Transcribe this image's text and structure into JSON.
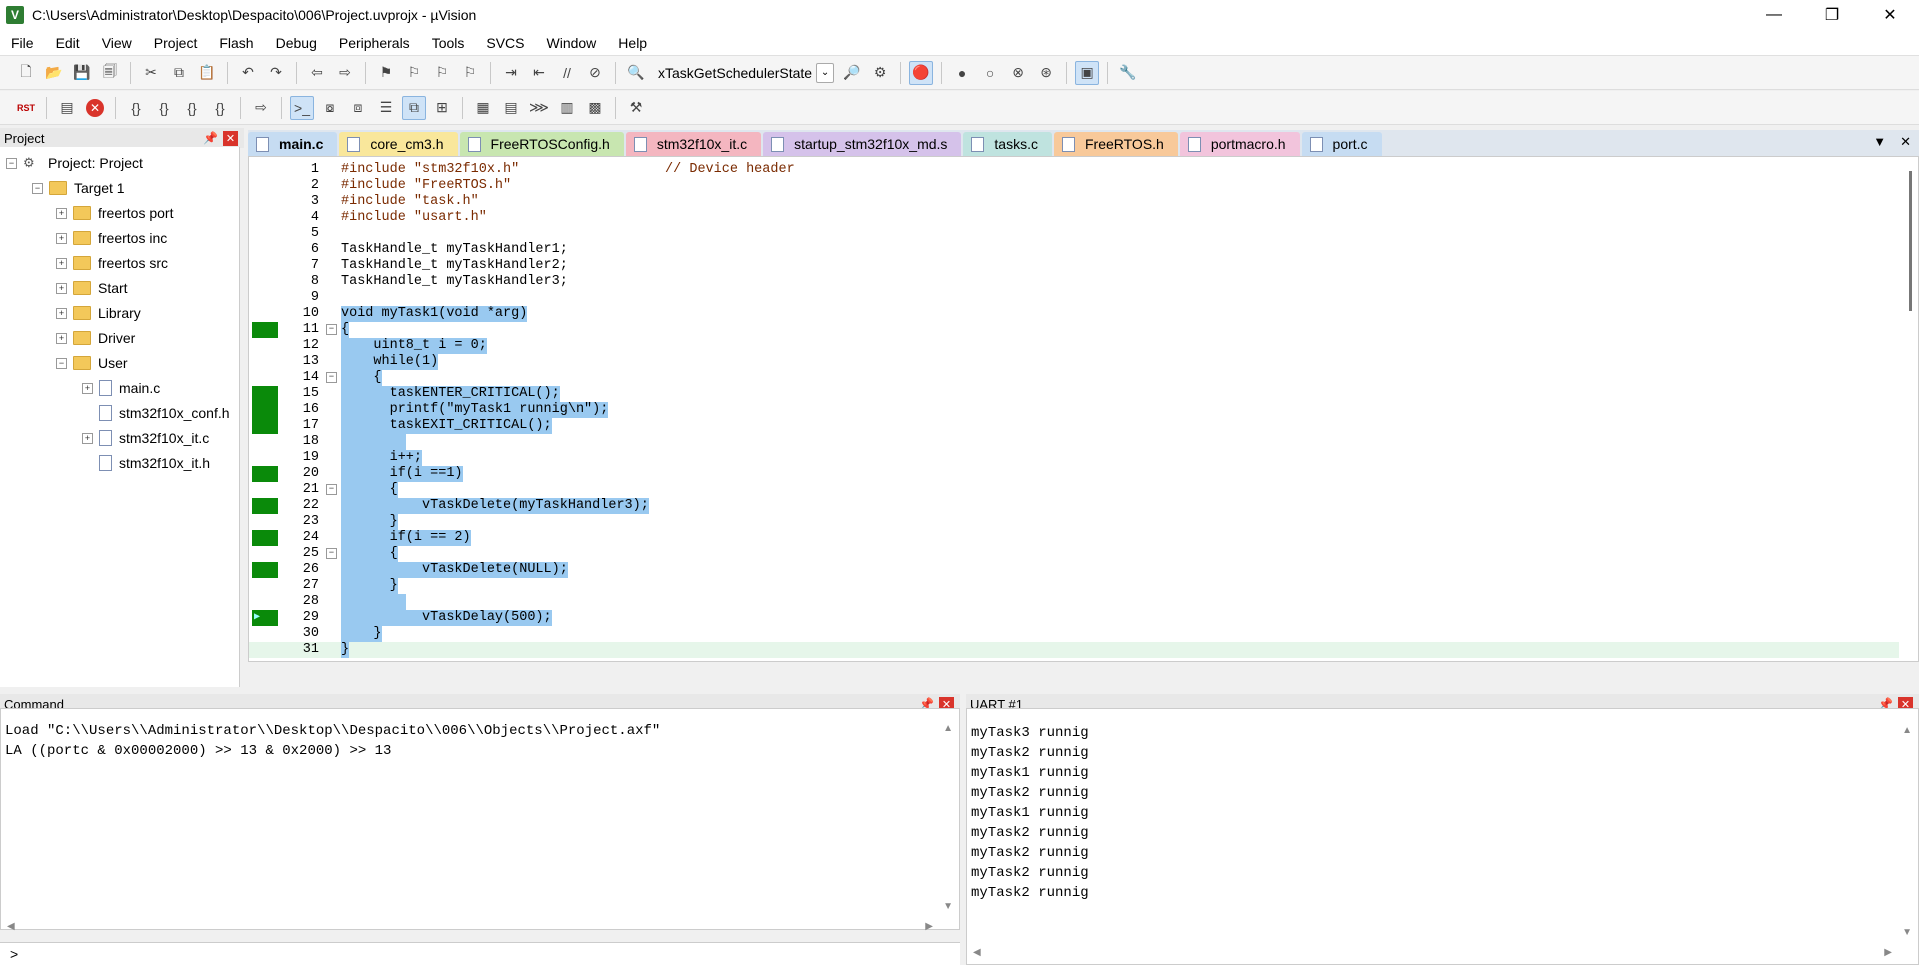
{
  "window": {
    "title": "C:\\Users\\Administrator\\Desktop\\Despacito\\006\\Project.uvprojx - µVision",
    "app_icon": "V",
    "minimize": "—",
    "restore": "❐",
    "close": "✕"
  },
  "menu": [
    "File",
    "Edit",
    "View",
    "Project",
    "Flash",
    "Debug",
    "Peripherals",
    "Tools",
    "SVCS",
    "Window",
    "Help"
  ],
  "toolbar": {
    "function_combo": "xTaskGetSchedulerState",
    "rst_label": "RST"
  },
  "project_panel": {
    "title": "Project",
    "root": "Project: Project",
    "target": "Target 1",
    "groups": [
      "freertos port",
      "freertos inc",
      "freertos src",
      "Start",
      "Library",
      "Driver",
      "User"
    ],
    "user_files": [
      "main.c",
      "stm32f10x_conf.h",
      "stm32f10x_it.c",
      "stm32f10x_it.h"
    ]
  },
  "tabs": [
    {
      "label": "main.c",
      "color": "#c6dcf2"
    },
    {
      "label": "core_cm3.h",
      "color": "#f9e79b"
    },
    {
      "label": "FreeRTOSConfig.h",
      "color": "#c8e6b0"
    },
    {
      "label": "stm32f10x_it.c",
      "color": "#f4b6c0"
    },
    {
      "label": "startup_stm32f10x_md.s",
      "color": "#d5c2ea"
    },
    {
      "label": "tasks.c",
      "color": "#bfe3df"
    },
    {
      "label": "FreeRTOS.h",
      "color": "#f8c99a"
    },
    {
      "label": "portmacro.h",
      "color": "#f2c4dc"
    },
    {
      "label": "port.c",
      "color": "#c6dcf2"
    }
  ],
  "code_lines": [
    {
      "n": "1",
      "t": "#include \"stm32f10x.h\"                  // Device header"
    },
    {
      "n": "2",
      "t": "#include \"FreeRTOS.h\""
    },
    {
      "n": "3",
      "t": "#include \"task.h\""
    },
    {
      "n": "4",
      "t": "#include \"usart.h\""
    },
    {
      "n": "5",
      "t": ""
    },
    {
      "n": "6",
      "t": "TaskHandle_t myTaskHandler1;"
    },
    {
      "n": "7",
      "t": "TaskHandle_t myTaskHandler2;"
    },
    {
      "n": "8",
      "t": "TaskHandle_t myTaskHandler3;"
    },
    {
      "n": "9",
      "t": ""
    },
    {
      "n": "10",
      "t": "void myTask1(void *arg)"
    },
    {
      "n": "11",
      "t": "{"
    },
    {
      "n": "12",
      "t": "    uint8_t i = 0;"
    },
    {
      "n": "13",
      "t": "    while(1)"
    },
    {
      "n": "14",
      "t": "    {"
    },
    {
      "n": "15",
      "t": "      taskENTER_CRITICAL();"
    },
    {
      "n": "16",
      "t": "      printf(\"myTask1 runnig\\n\");"
    },
    {
      "n": "17",
      "t": "      taskEXIT_CRITICAL();"
    },
    {
      "n": "18",
      "t": "        "
    },
    {
      "n": "19",
      "t": "      i++;"
    },
    {
      "n": "20",
      "t": "      if(i ==1)"
    },
    {
      "n": "21",
      "t": "      {"
    },
    {
      "n": "22",
      "t": "          vTaskDelete(myTaskHandler3);"
    },
    {
      "n": "23",
      "t": "      }"
    },
    {
      "n": "24",
      "t": "      if(i == 2)"
    },
    {
      "n": "25",
      "t": "      {"
    },
    {
      "n": "26",
      "t": "          vTaskDelete(NULL);"
    },
    {
      "n": "27",
      "t": "      }"
    },
    {
      "n": "28",
      "t": "        "
    },
    {
      "n": "29",
      "t": "          vTaskDelay(500);"
    },
    {
      "n": "30",
      "t": "    }"
    },
    {
      "n": "31",
      "t": "}"
    }
  ],
  "command_panel": {
    "title": "Command",
    "lines": [
      "Load \"C:\\\\Users\\\\Administrator\\\\Desktop\\\\Despacito\\\\006\\\\Objects\\\\Project.axf\"",
      "LA ((portc & 0x00002000) >> 13 & 0x2000) >> 13"
    ],
    "prompt": ">"
  },
  "uart_panel": {
    "title": "UART #1",
    "lines": [
      "myTask3 runnig",
      "myTask2 runnig",
      "myTask1 runnig",
      "myTask2 runnig",
      "myTask1 runnig",
      "myTask2 runnig",
      "myTask2 runnig",
      "myTask2 runnig",
      "myTask2 runnig"
    ]
  }
}
